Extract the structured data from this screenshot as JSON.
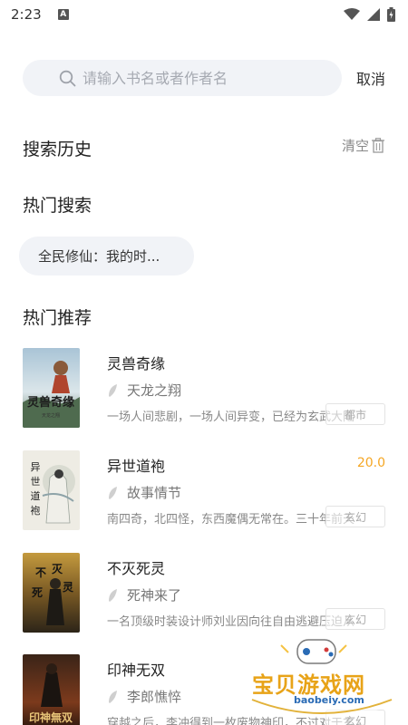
{
  "status_bar": {
    "time": "2:23",
    "notification_badge": "A"
  },
  "search": {
    "placeholder": "请输入书名或者作者名",
    "cancel_label": "取消"
  },
  "history": {
    "title": "搜索历史",
    "clear_label": "清空"
  },
  "hot_search": {
    "title": "热门搜索",
    "tags": [
      "全民修仙：我的时..."
    ]
  },
  "recommend": {
    "title": "热门推荐",
    "books": [
      {
        "title": "灵兽奇缘",
        "author": "天龙之翔",
        "desc": "一场人间悲剧，一场人间异变，已经为玄武大陆",
        "tag": "都市",
        "score": "",
        "cover_text": "灵兽奇缘",
        "cover_sub": "天龙之翔"
      },
      {
        "title": "异世道袍",
        "author": "故事情节",
        "desc": "南四奇，北四怪，东西魔偶无常在。三十年前天",
        "tag": "玄幻",
        "score": "20.0",
        "cover_text": "异世道袍",
        "cover_sub": ""
      },
      {
        "title": "不灭死灵",
        "author": "死神来了",
        "desc": "一名顶级时装设计师刘业因向往自由逃避压迫从",
        "tag": "玄幻",
        "score": "",
        "cover_text": "不灭死灵",
        "cover_sub": ""
      },
      {
        "title": "印神无双",
        "author": "李郎憔悴",
        "desc": "穿越之后，李冲得到一枚废物神印，不过对于玄",
        "tag": "玄幻",
        "score": "",
        "cover_text": "印神無双",
        "cover_sub": ""
      }
    ]
  },
  "watermark": {
    "name": "宝贝游戏网",
    "site": "baobeiy.com"
  },
  "colors": {
    "accent_score": "#f5a623",
    "search_bg": "#f1f3f7",
    "text_primary": "#222222",
    "text_muted": "#888888"
  }
}
